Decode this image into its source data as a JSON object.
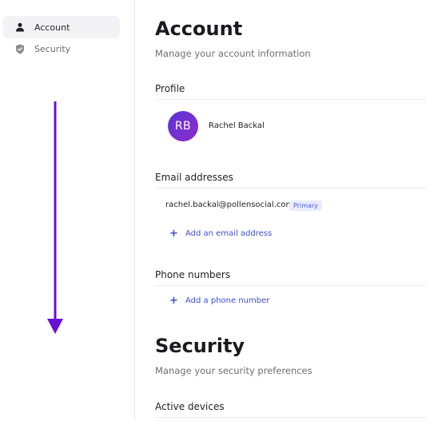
{
  "sidebar": {
    "items": [
      {
        "label": "Account",
        "icon": "user-icon",
        "active": true
      },
      {
        "label": "Security",
        "icon": "shield-icon",
        "active": false
      }
    ]
  },
  "account": {
    "title": "Account",
    "subtitle": "Manage your account information",
    "profile": {
      "section_title": "Profile",
      "initials": "RB",
      "name": "Rachel Backal"
    },
    "emails": {
      "section_title": "Email addresses",
      "items": [
        {
          "address": "rachel.backal@pollensocial.com",
          "badge": "Primary"
        }
      ],
      "add_label": "Add an email address"
    },
    "phones": {
      "section_title": "Phone numbers",
      "add_label": "Add a phone number"
    }
  },
  "security": {
    "title": "Security",
    "subtitle": "Manage your security preferences",
    "active_devices_title": "Active devices"
  },
  "colors": {
    "accent": "#3b4fd8",
    "annotation_arrow": "#6a0fd6",
    "avatar_gradient_start": "#5a35d6",
    "avatar_gradient_end": "#8c2bc9"
  }
}
